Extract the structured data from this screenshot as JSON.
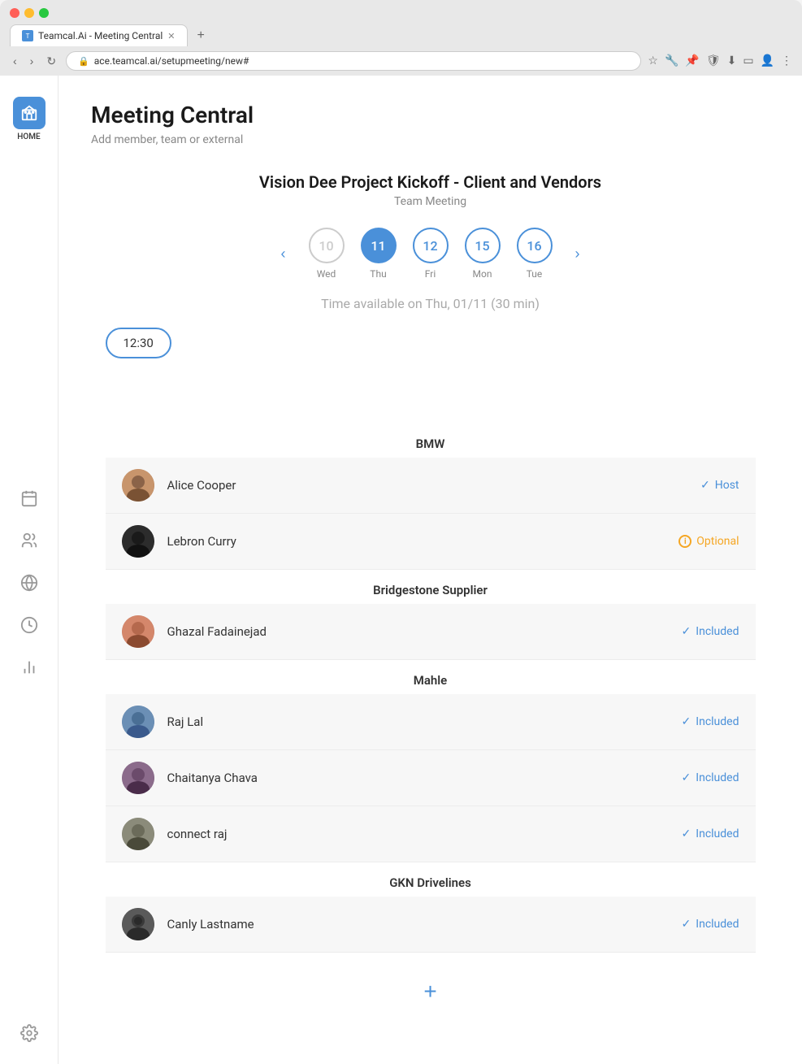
{
  "browser": {
    "tab_title": "Teamcal.Ai - Meeting Central",
    "url": "ace.teamcal.ai/setupmeeting/new#",
    "nav_back": "‹",
    "nav_forward": "›",
    "nav_refresh": "↻"
  },
  "sidebar": {
    "home_label": "HOME",
    "items": [
      {
        "name": "calendar",
        "icon": "📅"
      },
      {
        "name": "people",
        "icon": "👥"
      },
      {
        "name": "globe",
        "icon": "🌐"
      },
      {
        "name": "clock",
        "icon": "🕐"
      },
      {
        "name": "chart",
        "icon": "📊"
      },
      {
        "name": "settings",
        "icon": "⚙️"
      }
    ]
  },
  "page": {
    "title": "Meeting Central",
    "subtitle": "Add member, team or external"
  },
  "meeting": {
    "title": "Vision Dee Project Kickoff - Client and Vendors",
    "type": "Team Meeting",
    "time_available_text": "Time available on Thu, 01/11 (30 min)",
    "time_slot": "12:30",
    "dates": [
      {
        "day": "10",
        "label": "Wed",
        "state": "unavailable"
      },
      {
        "day": "11",
        "label": "Thu",
        "state": "selected"
      },
      {
        "day": "12",
        "label": "Fri",
        "state": "available"
      },
      {
        "day": "15",
        "label": "Mon",
        "state": "available"
      },
      {
        "day": "16",
        "label": "Tue",
        "state": "available"
      }
    ]
  },
  "groups": [
    {
      "name": "BMW",
      "members": [
        {
          "name": "Alice Cooper",
          "status": "Host",
          "status_type": "host",
          "avatar_class": "avatar-alice"
        },
        {
          "name": "Lebron Curry",
          "status": "Optional",
          "status_type": "optional",
          "avatar_class": "avatar-lebron"
        }
      ]
    },
    {
      "name": "Bridgestone Supplier",
      "members": [
        {
          "name": "Ghazal Fadainejad",
          "status": "Included",
          "status_type": "included",
          "avatar_class": "avatar-ghazal"
        }
      ]
    },
    {
      "name": "Mahle",
      "members": [
        {
          "name": "Raj Lal",
          "status": "Included",
          "status_type": "included",
          "avatar_class": "avatar-raj"
        },
        {
          "name": "Chaitanya Chava",
          "status": "Included",
          "status_type": "included",
          "avatar_class": "avatar-chaitanya"
        },
        {
          "name": "connect raj",
          "status": "Included",
          "status_type": "included",
          "avatar_class": "avatar-connect"
        }
      ]
    },
    {
      "name": "GKN Drivelines",
      "members": [
        {
          "name": "Canly Lastname",
          "status": "Included",
          "status_type": "included",
          "avatar_class": "avatar-canly"
        }
      ]
    }
  ],
  "add_button_label": "+"
}
